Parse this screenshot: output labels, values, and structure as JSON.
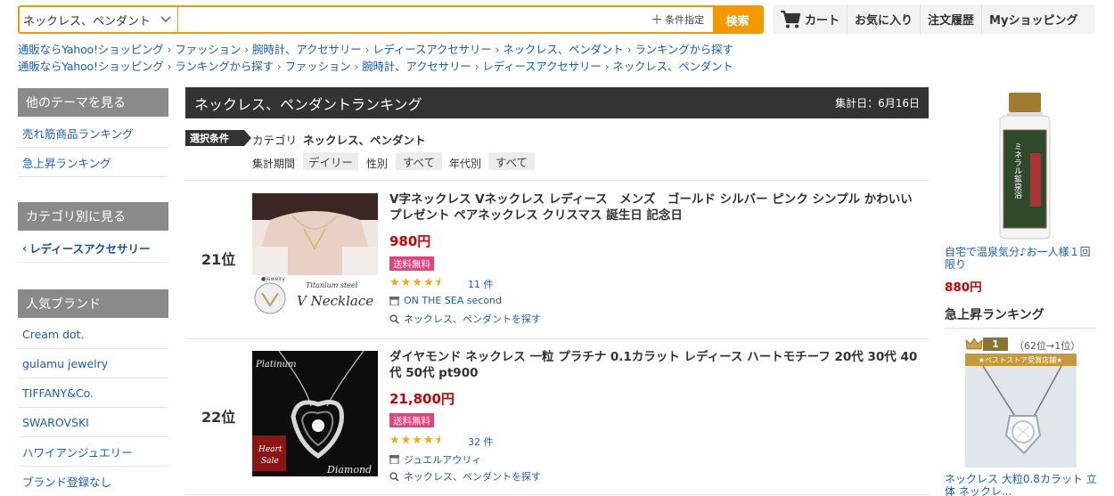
{
  "search": {
    "category_value": "ネックレス、ペンダント",
    "keyword_placeholder": "",
    "conditions_label": "条件指定",
    "button_label": "検索"
  },
  "nav": {
    "cart": "カート",
    "favorites": "お気に入り",
    "orders": "注文履歴",
    "my_shopping": "Myショッピング"
  },
  "breadcrumbs": [
    [
      "通販ならYahoo!ショッピング",
      "ファッション",
      "腕時計、アクセサリー",
      "レディースアクセサリー",
      "ネックレス、ペンダント",
      "ランキングから探す"
    ],
    [
      "通販ならYahoo!ショッピング",
      "ランキングから探す",
      "ファッション",
      "腕時計、アクセサリー",
      "レディースアクセサリー",
      "ネックレス、ペンダント"
    ]
  ],
  "sidebar": {
    "themes_header": "他のテーマを見る",
    "themes": [
      "売れ筋商品ランキング",
      "急上昇ランキング"
    ],
    "category_header": "カテゴリ別に見る",
    "category_back": "レディースアクセサリー",
    "brands_header": "人気ブランド",
    "brands": [
      "Cream dot.",
      "gulamu jewelry",
      "TIFFANY&Co.",
      "SWAROVSKI",
      "ハワイアンジュエリー",
      "ブランド登録なし"
    ]
  },
  "ranking": {
    "title": "ネックレス、ペンダントランキング",
    "date": "集計日：6月16日",
    "condition_badge": "選択条件",
    "category_label": "カテゴリ",
    "category_value": "ネックレス、ペンダント",
    "period_label": "集計期間",
    "period_value": "デイリー",
    "gender_label": "性別",
    "gender_value": "すべて",
    "age_label": "年代別",
    "age_value": "すべて"
  },
  "products": [
    {
      "rank": "21位",
      "title": "V字ネックレス Vネックレス レディース　メンズ　ゴールド シルバー ピンク シンプル かわいい　プレゼント ペアネックレス クリスマス 誕生日 記念日",
      "price": "980円",
      "shipping": "送料無料",
      "rating": 4.5,
      "reviews": "11 件",
      "store": "ON THE SEA second",
      "find_similar": "ネックレス、ペンダントを探す",
      "image_text": [
        "Titanium steel",
        "V Necklace",
        "●jewelry"
      ]
    },
    {
      "rank": "22位",
      "title": "ダイヤモンド ネックレス 一粒 プラチナ 0.1カラット レディース ハートモチーフ 20代 30代 40代 50代 pt900",
      "price": "21,800円",
      "shipping": "送料無料",
      "rating": 4.5,
      "reviews": "32 件",
      "store": "ジュエルアウリィ",
      "find_similar": "ネックレス、ペンダントを探す",
      "image_text": [
        "Platinum",
        "Heart",
        "Sale",
        "Diamond"
      ]
    }
  ],
  "ad": {
    "title": "自宅で温泉気分♪お一人様１回限り",
    "price": "880円",
    "label_text": "ミネラル鉱泉浴"
  },
  "surge": {
    "header": "急上昇ランキング",
    "rank": "1",
    "change": "（62位→1位）",
    "store_banner": "★ベストストア受賞店舗★",
    "title": "ネックレス 大粒0.8カラット 立体 ネックレ..."
  },
  "colors": {
    "accent": "#f39800",
    "link": "#1a5fb4",
    "price": "#cc0000",
    "shipping_badge": "#e6417d",
    "star": "#f0a818",
    "sidebar_header": "#8a8a8a",
    "ranking_header": "#333333"
  }
}
